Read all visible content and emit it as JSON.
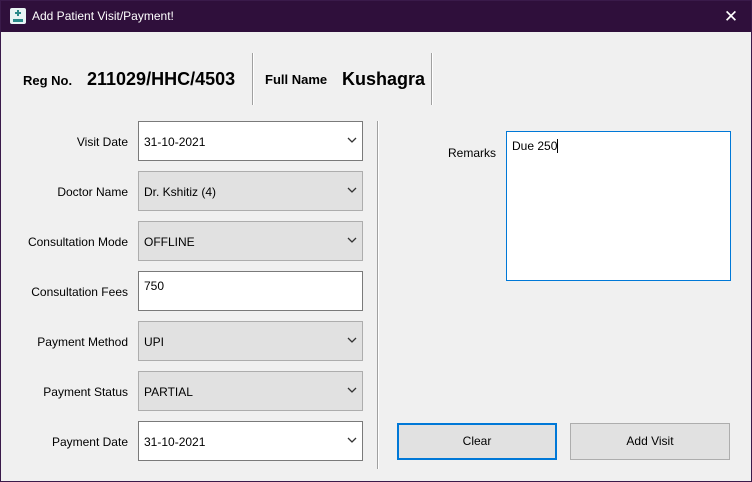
{
  "window": {
    "title": "Add Patient Visit/Payment!"
  },
  "header": {
    "reg_label": "Reg No.",
    "reg_value": "211029/HHC/4503",
    "name_label": "Full Name",
    "name_value": "Kushagra"
  },
  "form": {
    "visit_date": {
      "label": "Visit Date",
      "value": "31-10-2021"
    },
    "doctor_name": {
      "label": "Doctor Name",
      "value": "Dr. Kshitiz (4)"
    },
    "consultation_mode": {
      "label": "Consultation Mode",
      "value": "OFFLINE"
    },
    "consultation_fees": {
      "label": "Consultation Fees",
      "value": "750"
    },
    "payment_method": {
      "label": "Payment Method",
      "value": "UPI"
    },
    "payment_status": {
      "label": "Payment Status",
      "value": "PARTIAL"
    },
    "payment_date": {
      "label": "Payment Date",
      "value": "31-10-2021"
    },
    "remarks": {
      "label": "Remarks",
      "value": "Due 250"
    }
  },
  "buttons": {
    "clear": "Clear",
    "add_visit": "Add Visit"
  },
  "icons": {
    "app": "clinic-app-icon",
    "close": "close-icon",
    "dropdown": "chevron-down-icon"
  },
  "colors": {
    "titlebar": "#2f0f3b",
    "focus": "#0078d7"
  }
}
